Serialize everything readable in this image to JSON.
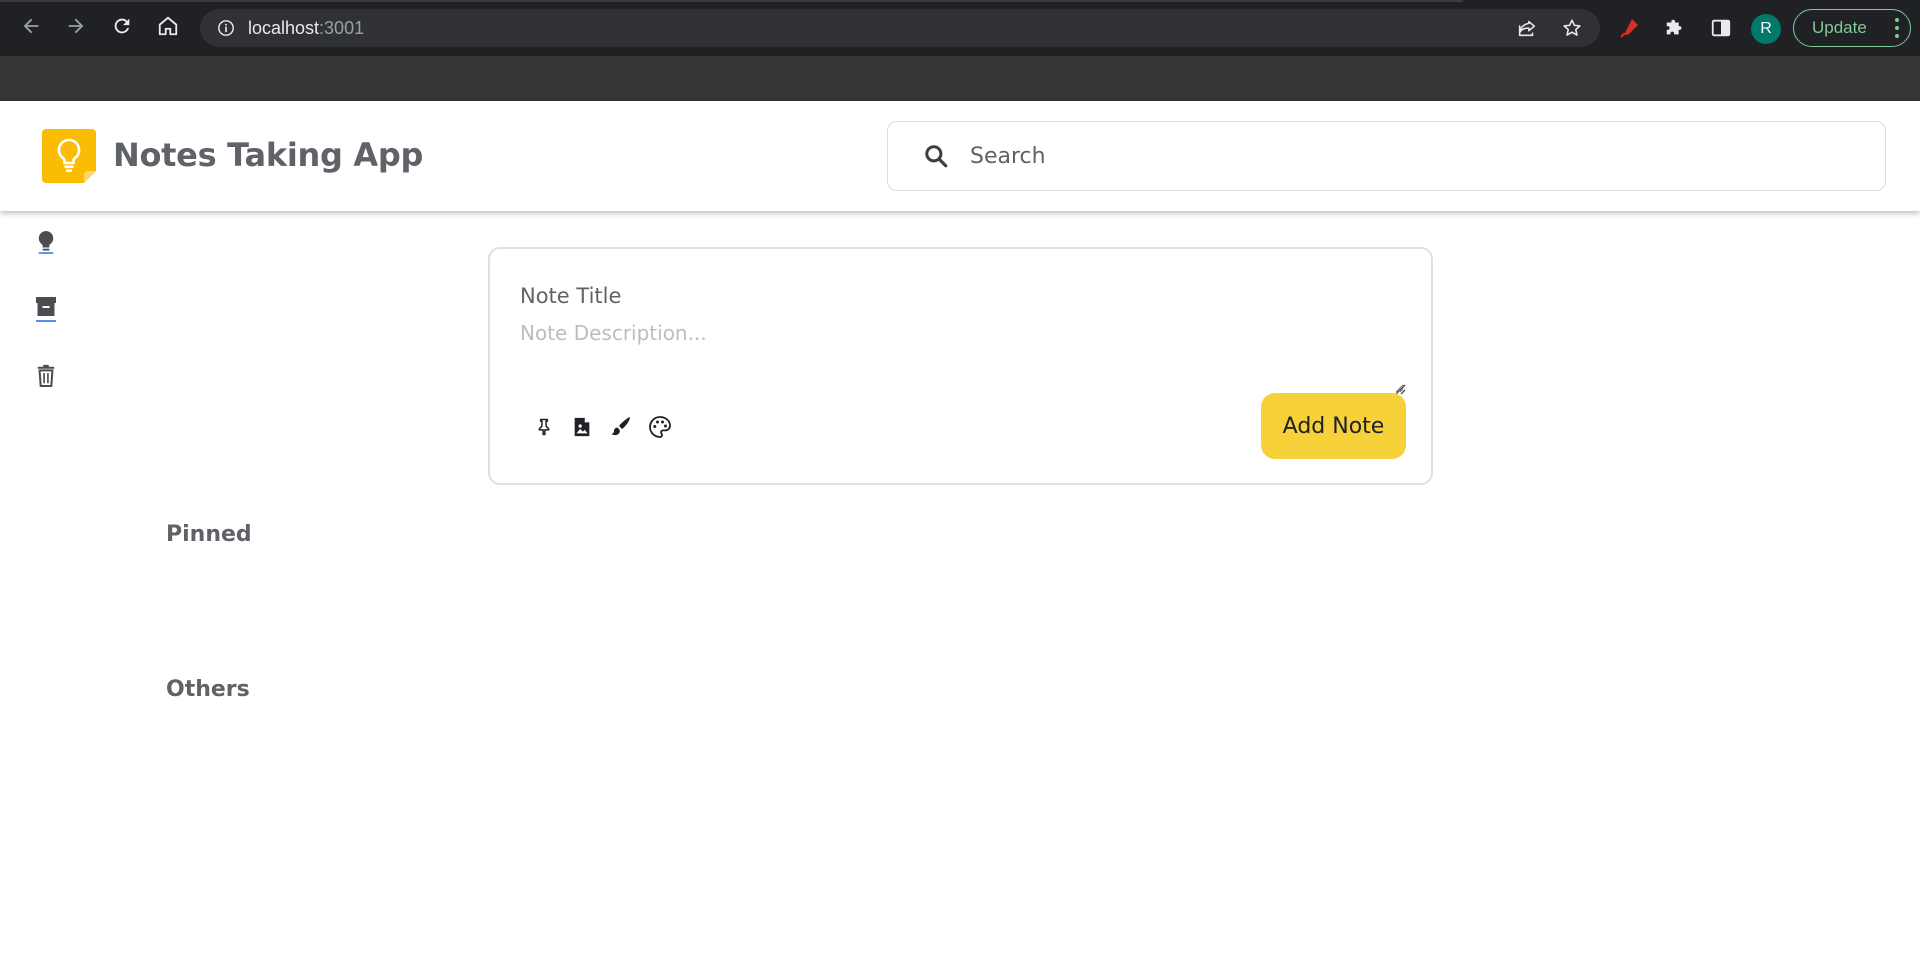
{
  "browser": {
    "url_host": "localhost",
    "url_port": ":3001",
    "profile_initial": "R",
    "update_label": "Update",
    "accent_update": "#81c995"
  },
  "header": {
    "title": "Notes Taking App",
    "logo_icon": "lightbulb-logo-icon",
    "search": {
      "placeholder": "Search",
      "value": ""
    }
  },
  "sidebar": {
    "items": [
      {
        "name": "notes",
        "icon": "lightbulb-icon"
      },
      {
        "name": "archive",
        "icon": "archive-icon"
      },
      {
        "name": "trash",
        "icon": "trash-icon"
      }
    ]
  },
  "note_form": {
    "title_placeholder": "Note Title",
    "title_value": "",
    "description_placeholder": "Note Description...",
    "description_value": "",
    "tools": [
      "pin-icon",
      "image-icon",
      "brush-icon",
      "palette-icon"
    ],
    "submit_label": "Add Note",
    "submit_color": "#f6d13a"
  },
  "sections": {
    "pinned": "Pinned",
    "others": "Others"
  }
}
